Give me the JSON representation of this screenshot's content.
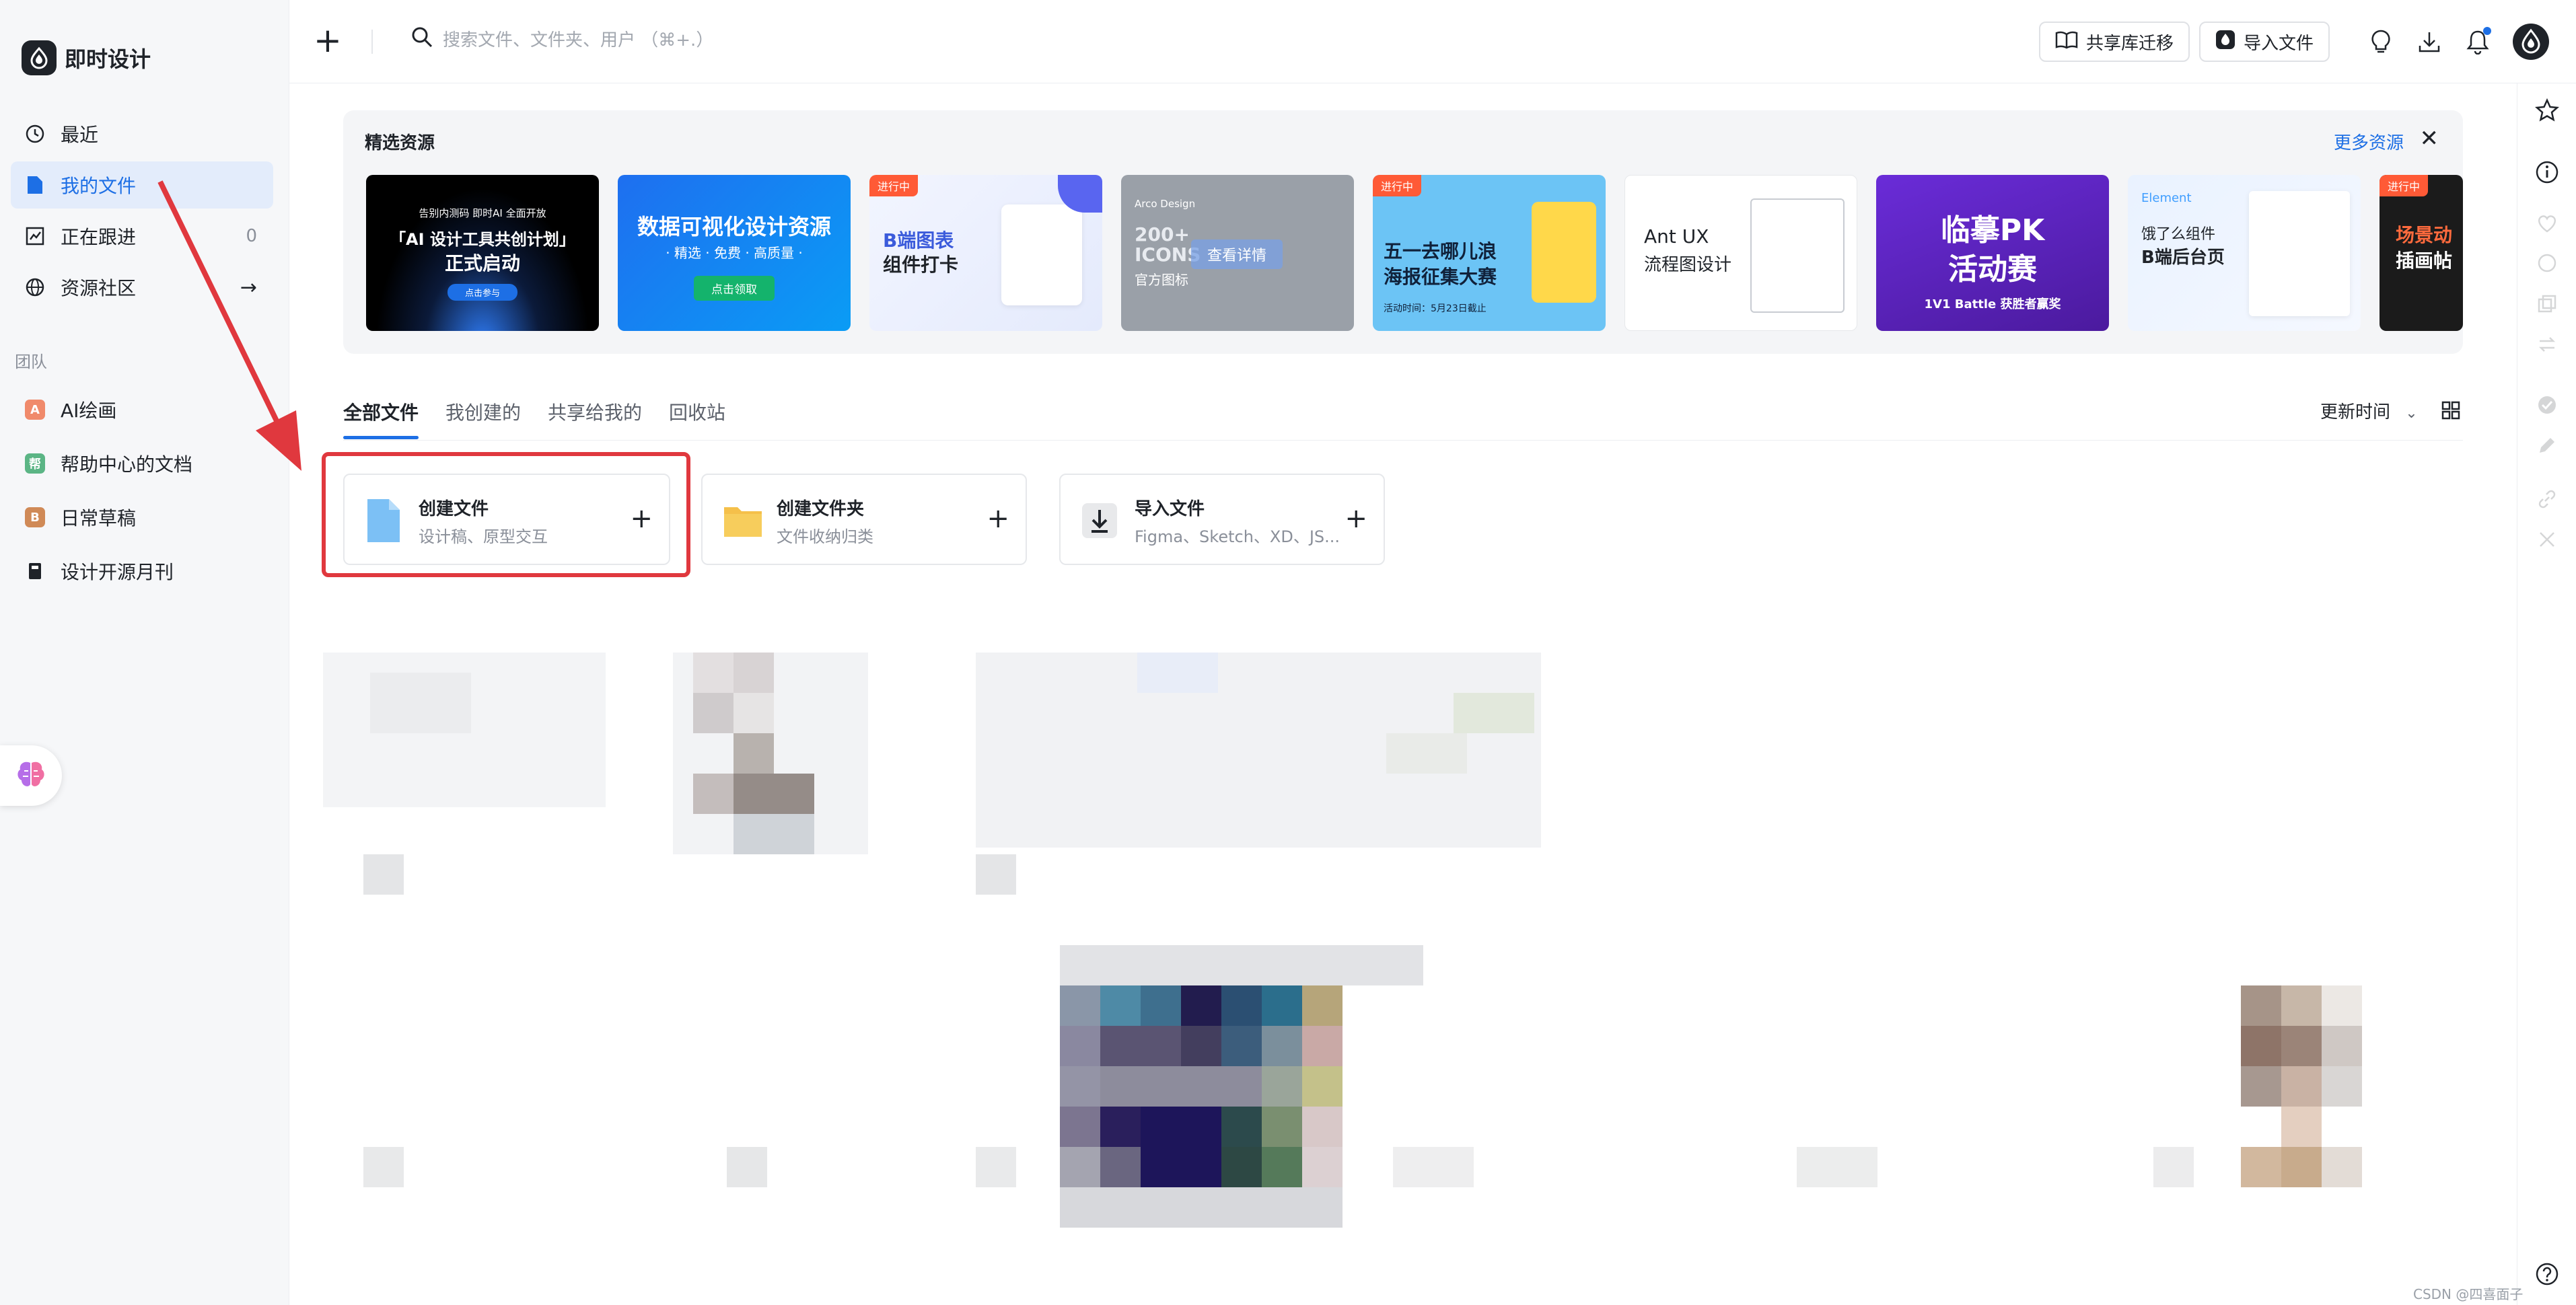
{
  "app": {
    "name": "即时设计"
  },
  "sidebar": {
    "items": [
      {
        "label": "最近"
      },
      {
        "label": "我的文件"
      },
      {
        "label": "正在跟进",
        "count": "0"
      },
      {
        "label": "资源社区"
      }
    ],
    "team_title": "团队",
    "team_items": [
      {
        "label": "AI绘画",
        "badge": "A",
        "color": "#f08a6b"
      },
      {
        "label": "帮助中心的文档",
        "badge": "帮",
        "color": "#5bb585"
      },
      {
        "label": "日常草稿",
        "badge": "B",
        "color": "#d08a57"
      },
      {
        "label": "设计开源月刊"
      }
    ]
  },
  "topbar": {
    "search_placeholder": "搜索文件、文件夹、用户 （⌘+.）",
    "migrate_label": "共享库迁移",
    "import_label": "导入文件"
  },
  "resources": {
    "title": "精选资源",
    "more": "更多资源",
    "cards": [
      {
        "lines": [
          "告别内测码 即时AI 全面开放",
          "「AI 设计工具共创计划」",
          "正式启动",
          "点击参与"
        ]
      },
      {
        "lines": [
          "数据可视化设计资源",
          "· 精选 · 免费 · 高质量 ·",
          "点击领取"
        ]
      },
      {
        "tag": "进行中",
        "lines": [
          "B端图表",
          "组件打卡"
        ]
      },
      {
        "lines": [
          "Arco Design",
          "200+",
          "ICONS",
          "官方图标",
          "查看详情"
        ]
      },
      {
        "tag": "进行中",
        "lines": [
          "五一去哪儿浪",
          "海报征集大赛",
          "活动时间：5月23日截止"
        ]
      },
      {
        "lines": [
          "Ant UX",
          "流程图设计"
        ]
      },
      {
        "lines": [
          "临摹PK",
          "活动赛",
          "1V1 Battle 获胜者赢奖"
        ]
      },
      {
        "lines": [
          "Element",
          "饿了么组件",
          "B端后台页"
        ]
      },
      {
        "tag": "进行中",
        "lines": [
          "场景动",
          "插画帖"
        ]
      }
    ]
  },
  "tabs": [
    {
      "label": "全部文件"
    },
    {
      "label": "我创建的"
    },
    {
      "label": "共享给我的"
    },
    {
      "label": "回收站"
    }
  ],
  "sort_label": "更新时间",
  "create_cards": [
    {
      "title": "创建文件",
      "subtitle": "设计稿、原型交互"
    },
    {
      "title": "创建文件夹",
      "subtitle": "文件收纳归类"
    },
    {
      "title": "导入文件",
      "subtitle": "Figma、Sketch、XD、JS..."
    }
  ],
  "watermark": "CSDN @四喜面子",
  "colors": {
    "accent": "#1d6fe5",
    "highlight": "#e0383e",
    "active_bg": "#e3ecfb"
  }
}
